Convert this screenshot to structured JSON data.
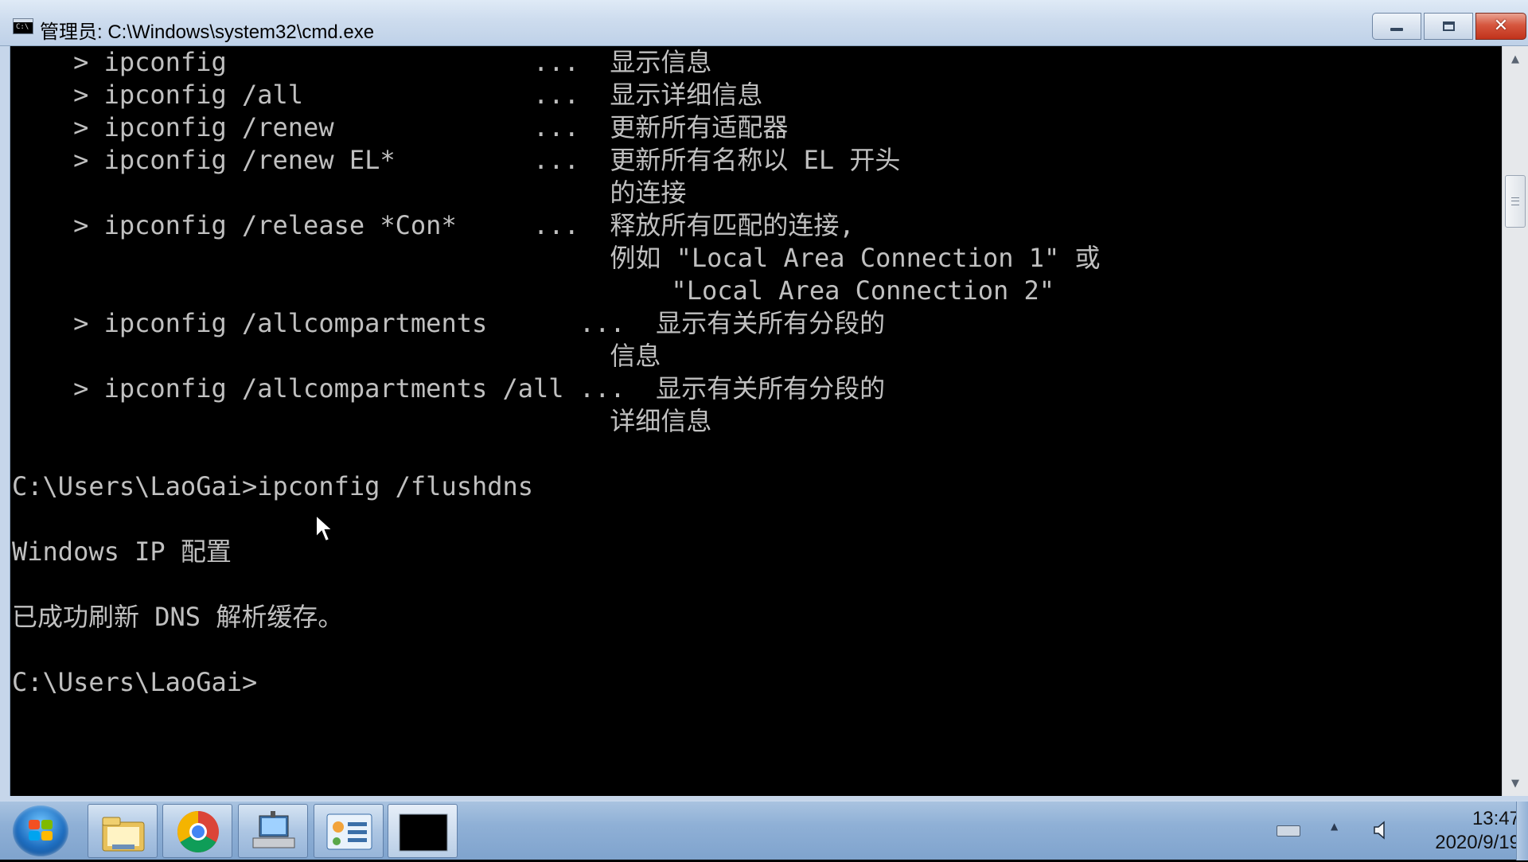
{
  "window": {
    "title": "管理员: C:\\Windows\\system32\\cmd.exe",
    "icon_glyph": "C:\\",
    "buttons": {
      "minimize": "minimize-icon",
      "maximize": "maximize-icon",
      "close": "✕"
    }
  },
  "console": {
    "lines": [
      "    > ipconfig                    ...  显示信息",
      "    > ipconfig /all               ...  显示详细信息",
      "    > ipconfig /renew             ...  更新所有适配器",
      "    > ipconfig /renew EL*         ...  更新所有名称以 EL 开头",
      "                                       的连接",
      "    > ipconfig /release *Con*     ...  释放所有匹配的连接,",
      "                                       例如 \"Local Area Connection 1\" 或",
      "                                           \"Local Area Connection 2\"",
      "    > ipconfig /allcompartments      ...  显示有关所有分段的",
      "                                       信息",
      "    > ipconfig /allcompartments /all ...  显示有关所有分段的",
      "                                       详细信息",
      "",
      "C:\\Users\\LaoGai>ipconfig /flushdns",
      "",
      "Windows IP 配置",
      "",
      "已成功刷新 DNS 解析缓存。",
      "",
      "C:\\Users\\LaoGai>"
    ]
  },
  "scrollbar": {
    "up_arrow": "▲",
    "down_arrow": "▼"
  },
  "taskbar": {
    "apps": [
      "file-explorer",
      "chrome",
      "network-connections",
      "control-panel",
      "command-prompt"
    ],
    "tray": {
      "arrow": "▲"
    },
    "clock": {
      "time": "13:47",
      "date": "2020/9/19"
    }
  }
}
